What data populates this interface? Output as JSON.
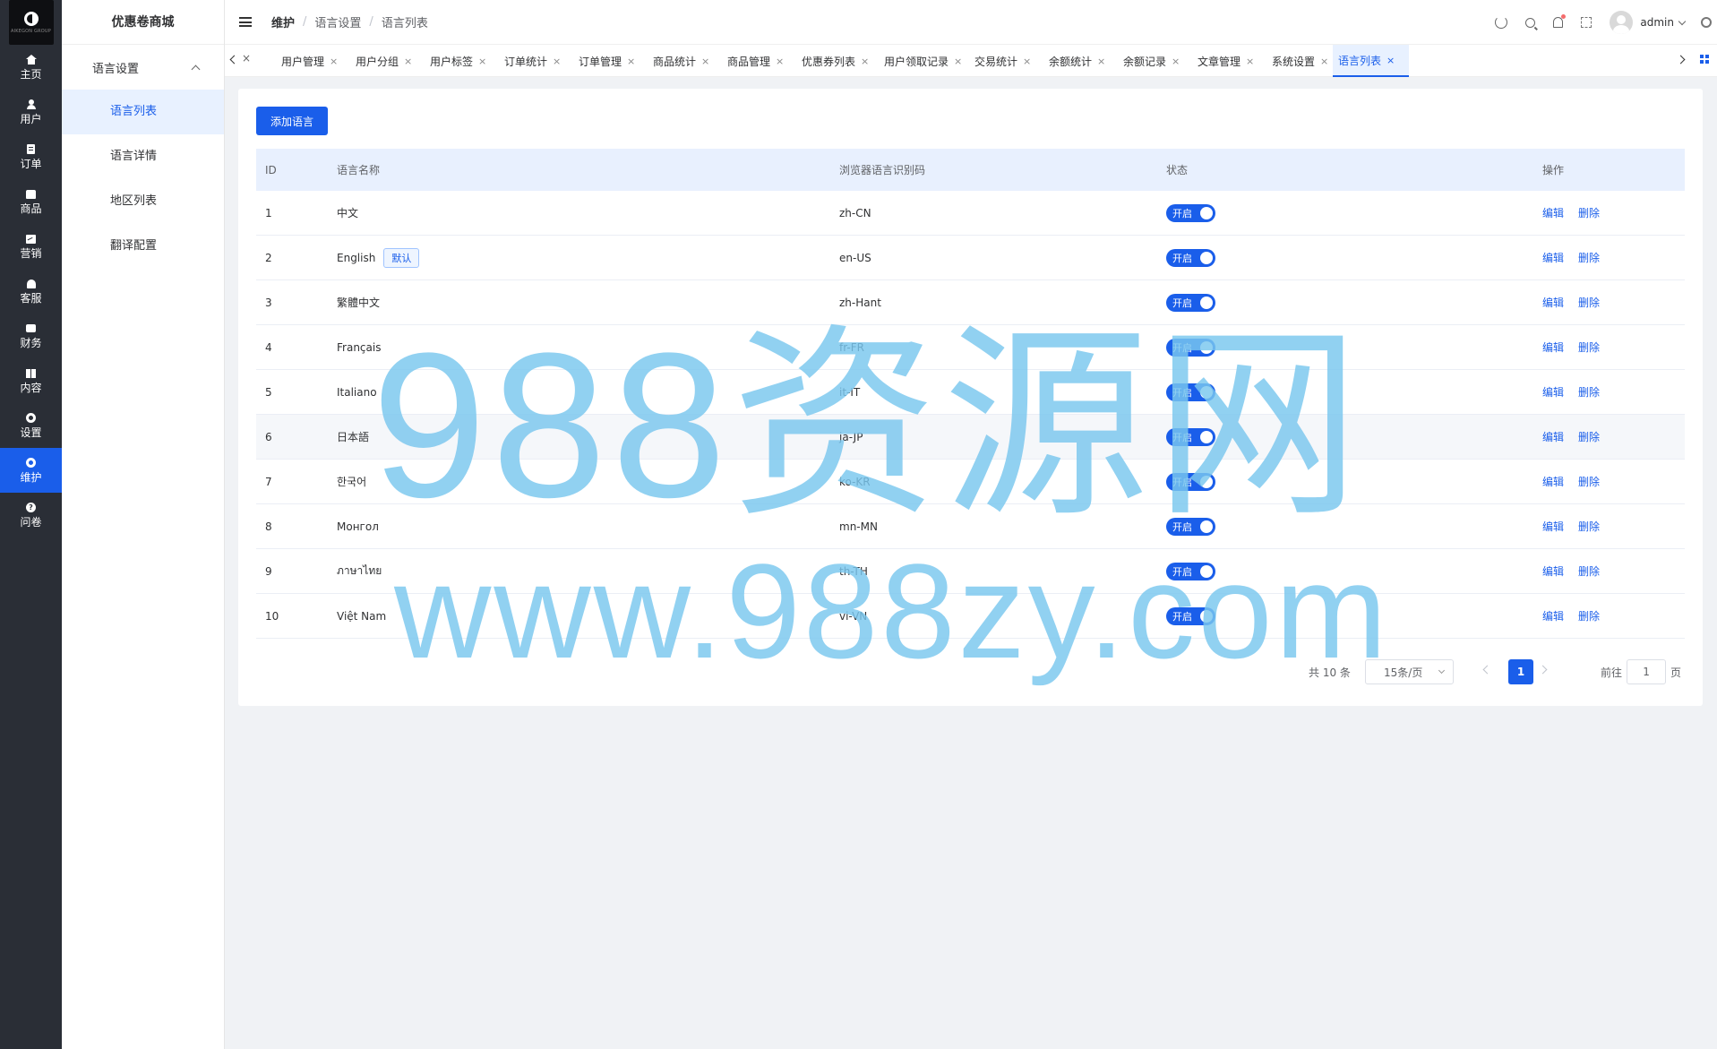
{
  "brand": {
    "logo_text": "AIKEGON GROUP"
  },
  "rail": [
    {
      "label": "主页",
      "icon": "home-icon"
    },
    {
      "label": "用户",
      "icon": "user-icon"
    },
    {
      "label": "订单",
      "icon": "order-icon"
    },
    {
      "label": "商品",
      "icon": "goods-icon"
    },
    {
      "label": "营销",
      "icon": "marketing-icon"
    },
    {
      "label": "客服",
      "icon": "service-icon"
    },
    {
      "label": "财务",
      "icon": "finance-icon"
    },
    {
      "label": "内容",
      "icon": "content-icon"
    },
    {
      "label": "设置",
      "icon": "settings-icon"
    },
    {
      "label": "维护",
      "icon": "maintain-icon",
      "active": true
    },
    {
      "label": "问卷",
      "icon": "question-icon"
    }
  ],
  "sidebar": {
    "title": "优惠卷商城",
    "group": "语言设置",
    "items": [
      "语言列表",
      "语言详情",
      "地区列表",
      "翻译配置"
    ]
  },
  "header": {
    "breadcrumb": [
      "维护",
      "语言设置",
      "语言列表"
    ],
    "breadcrumb_sep": "/",
    "username": "admin"
  },
  "tags": [
    "用户管理",
    "用户分组",
    "用户标签",
    "订单统计",
    "订单管理",
    "商品统计",
    "商品管理",
    "优惠券列表",
    "用户领取记录",
    "交易统计",
    "余额统计",
    "余额记录",
    "文章管理",
    "系统设置",
    "语言列表"
  ],
  "tag_close": "×",
  "main": {
    "add_button": "添加语言",
    "columns": [
      "ID",
      "语言名称",
      "浏览器语言识别码",
      "状态",
      "操作"
    ],
    "default_badge": "默认",
    "switch_on_label": "开启",
    "edit_label": "编辑",
    "delete_label": "删除",
    "rows": [
      {
        "id": "1",
        "name": "中文",
        "code": "zh-CN",
        "default": false
      },
      {
        "id": "2",
        "name": "English",
        "code": "en-US",
        "default": true
      },
      {
        "id": "3",
        "name": "繁體中文",
        "code": "zh-Hant",
        "default": false
      },
      {
        "id": "4",
        "name": "Français",
        "code": "fr-FR",
        "default": false
      },
      {
        "id": "5",
        "name": "Italiano",
        "code": "it-IT",
        "default": false
      },
      {
        "id": "6",
        "name": "日本語",
        "code": "ja-JP",
        "default": false
      },
      {
        "id": "7",
        "name": "한국어",
        "code": "ko-KR",
        "default": false
      },
      {
        "id": "8",
        "name": "Монгол",
        "code": "mn-MN",
        "default": false
      },
      {
        "id": "9",
        "name": "ภาษาไทย",
        "code": "th-TH",
        "default": false
      },
      {
        "id": "10",
        "name": "Việt Nam",
        "code": "vi-VN",
        "default": false
      }
    ]
  },
  "pagination": {
    "total_text": "共 10 条",
    "page_size": "15条/页",
    "current": "1",
    "goto_prefix": "前往",
    "goto_value": "1",
    "goto_suffix": "页"
  },
  "watermark": {
    "line1": "988资源网",
    "line2": "www.988zy.com"
  },
  "colors": {
    "primary": "#1a5eea",
    "rail_bg": "#2a2e36",
    "watermark": "#7ac7ef"
  }
}
